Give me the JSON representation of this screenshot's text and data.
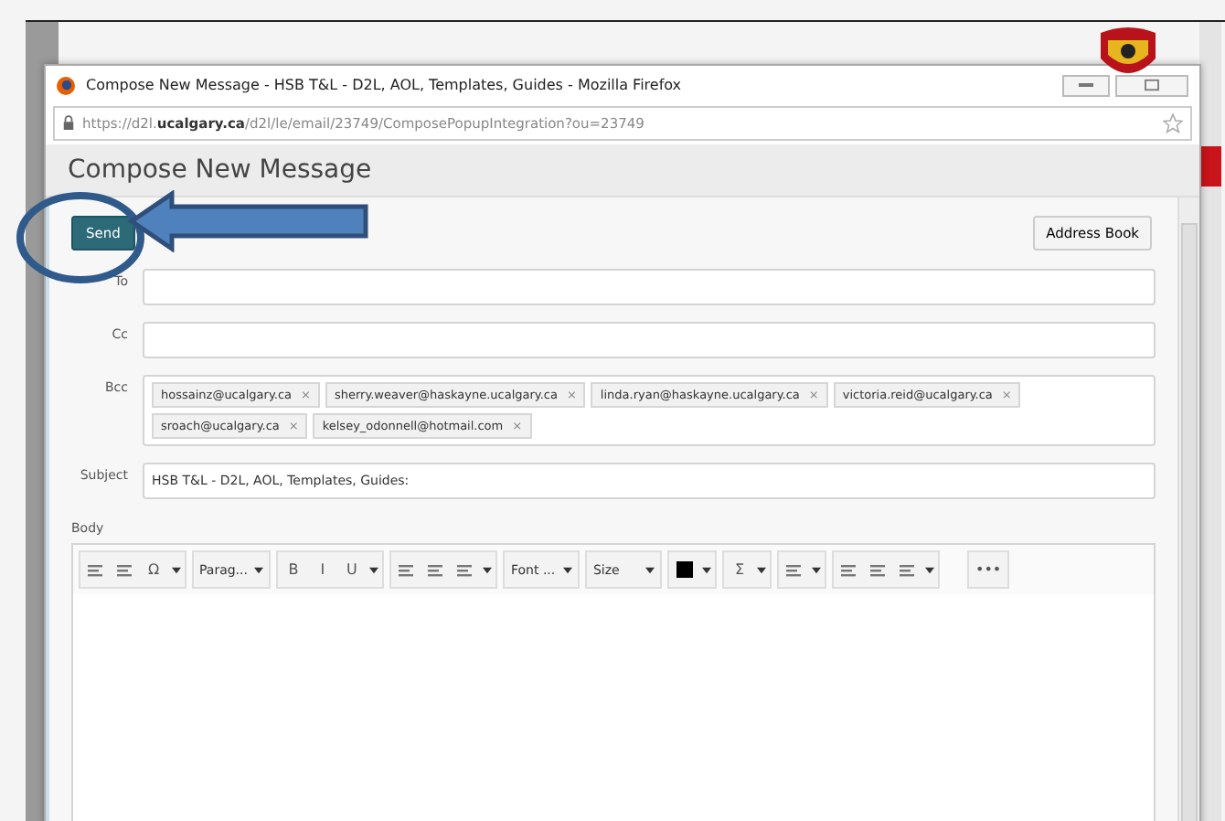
{
  "window": {
    "title": "Compose New Message - HSB T&L - D2L, AOL, Templates, Guides - Mozilla Firefox",
    "url_plain_start": "https://d2l.",
    "url_bold": "ucalgary.ca",
    "url_plain_end": "/d2l/le/email/23749/ComposePopupIntegration?ou=23749"
  },
  "header": {
    "title": "Compose New Message"
  },
  "buttons": {
    "send": "Send",
    "address_book": "Address Book"
  },
  "fields": [
    {
      "label": "To",
      "kind": "input"
    },
    {
      "label": "Cc",
      "kind": "input"
    },
    {
      "label": "Bcc",
      "kind": "chips",
      "chips": [
        "hossainz@ucalgary.ca",
        "sherry.weaver@haskayne.ucalgary.ca",
        "linda.ryan@haskayne.ucalgary.ca",
        "victoria.reid@ucalgary.ca",
        "sroach@ucalgary.ca",
        "kelsey_odonnell@hotmail.com"
      ]
    },
    {
      "label": "Subject",
      "kind": "input",
      "value": "HSB T&L - D2L, AOL, Templates, Guides:"
    }
  ],
  "chip_remove": "×",
  "body": {
    "label": "Body",
    "toolbar": [
      [
        {
          "kind": "tool"
        },
        {
          "kind": "tool"
        },
        {
          "kind": "glyph",
          "label": "Ω"
        },
        {
          "kind": "caret"
        }
      ],
      [
        {
          "kind": "select",
          "label": "Parag..."
        }
      ],
      [
        {
          "kind": "glyph",
          "label": "B"
        },
        {
          "kind": "glyph",
          "label": "I"
        },
        {
          "kind": "glyph",
          "label": "U"
        },
        {
          "kind": "caret"
        }
      ],
      [
        {
          "kind": "tool"
        },
        {
          "kind": "tool"
        },
        {
          "kind": "tool"
        },
        {
          "kind": "caret"
        }
      ],
      [
        {
          "kind": "select",
          "label": "Font ..."
        }
      ],
      [
        {
          "kind": "select",
          "label": "Size"
        }
      ],
      [
        {
          "kind": "swatch"
        },
        {
          "kind": "caret"
        }
      ],
      [
        {
          "kind": "glyph",
          "label": "Σ"
        },
        {
          "kind": "caret"
        }
      ],
      [
        {
          "kind": "tool"
        },
        {
          "kind": "caret"
        }
      ],
      [
        {
          "kind": "tool"
        },
        {
          "kind": "tool"
        },
        {
          "kind": "tool"
        },
        {
          "kind": "caret"
        }
      ],
      [
        {
          "kind": "glyph",
          "label": "•••"
        }
      ]
    ]
  }
}
